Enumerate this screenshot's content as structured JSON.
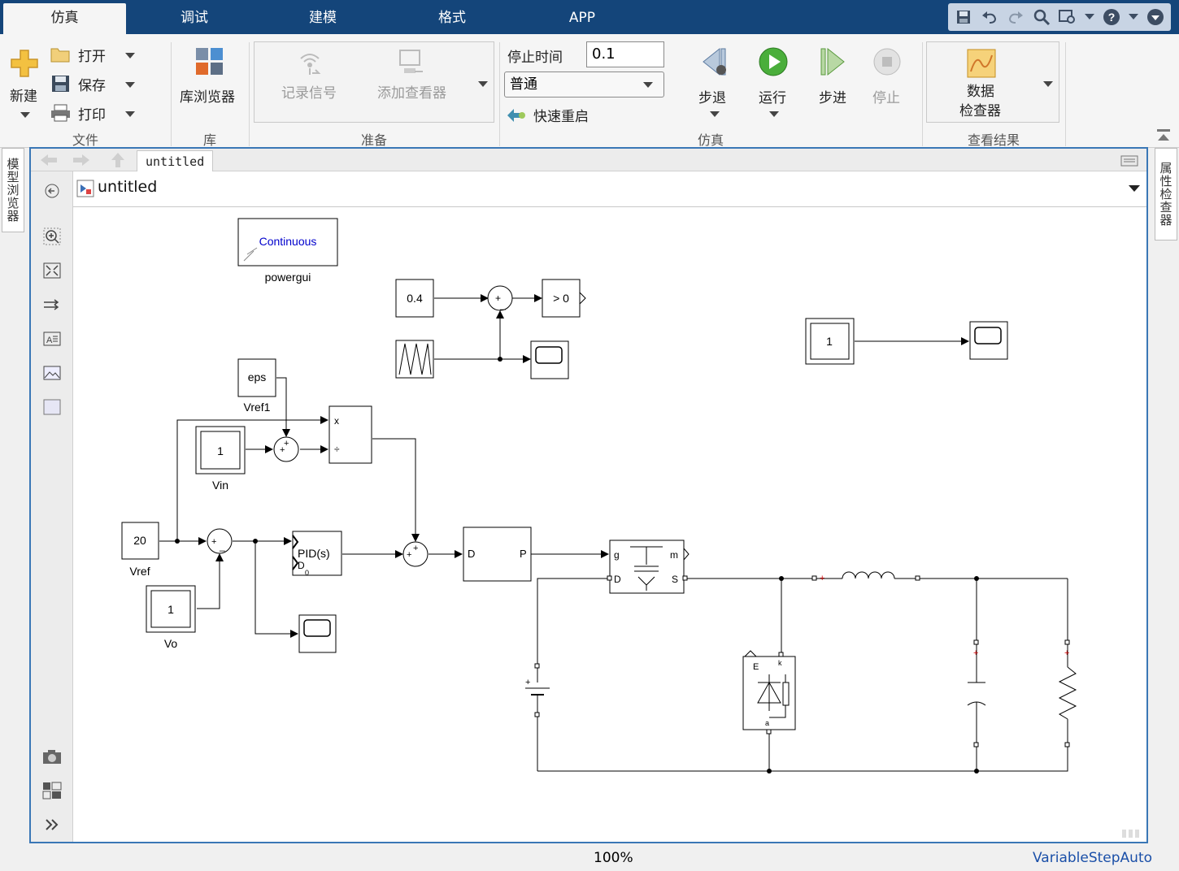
{
  "tabs": [
    "仿真",
    "调试",
    "建模",
    "格式",
    "APP"
  ],
  "active_tab": "仿真",
  "ribbon": {
    "file": {
      "new": "新建",
      "open": "打开",
      "save": "保存",
      "print": "打印",
      "label": "文件"
    },
    "library": {
      "browser": "库浏览器",
      "label": "库"
    },
    "prepare": {
      "log_signals": "记录信号",
      "add_viewer": "添加查看器",
      "label": "准备"
    },
    "simulate": {
      "stop_time_label": "停止时间",
      "stop_time_value": "0.1",
      "mode": "普通",
      "fast_restart": "快速重启",
      "step_back": "步退",
      "run": "运行",
      "step_forward": "步进",
      "stop": "停止",
      "label": "仿真"
    },
    "review": {
      "data_inspector_line1": "数据",
      "data_inspector_line2": "检查器",
      "label": "查看结果"
    }
  },
  "side_tabs": {
    "left": "模型浏览器",
    "right": "属性检查器"
  },
  "editor": {
    "doc_tab": "untitled",
    "address": "untitled"
  },
  "model": {
    "powergui_text": "Continuous",
    "powergui_label": "powergui",
    "const_04": "0.4",
    "compare": "> 0",
    "const_1_right": "1",
    "eps": "eps",
    "vref1_label": "Vref1",
    "vin_value": "1",
    "vin_label": "Vin",
    "vref_value": "20",
    "vref_label": "Vref",
    "vo_value": "1",
    "vo_label": "Vo",
    "product_x": "x",
    "product_div": "÷",
    "pid_text": "PID(s)",
    "pid_d0": "D",
    "pid_sub": "0",
    "dp_in": "D",
    "dp_out": "P",
    "mos_g": "g",
    "mos_m": "m",
    "mos_d": "D",
    "mos_s": "S",
    "diode_e": "E",
    "diode_k": "k",
    "diode_a": "a"
  },
  "status": {
    "zoom": "100%",
    "solver": "VariableStepAuto"
  }
}
